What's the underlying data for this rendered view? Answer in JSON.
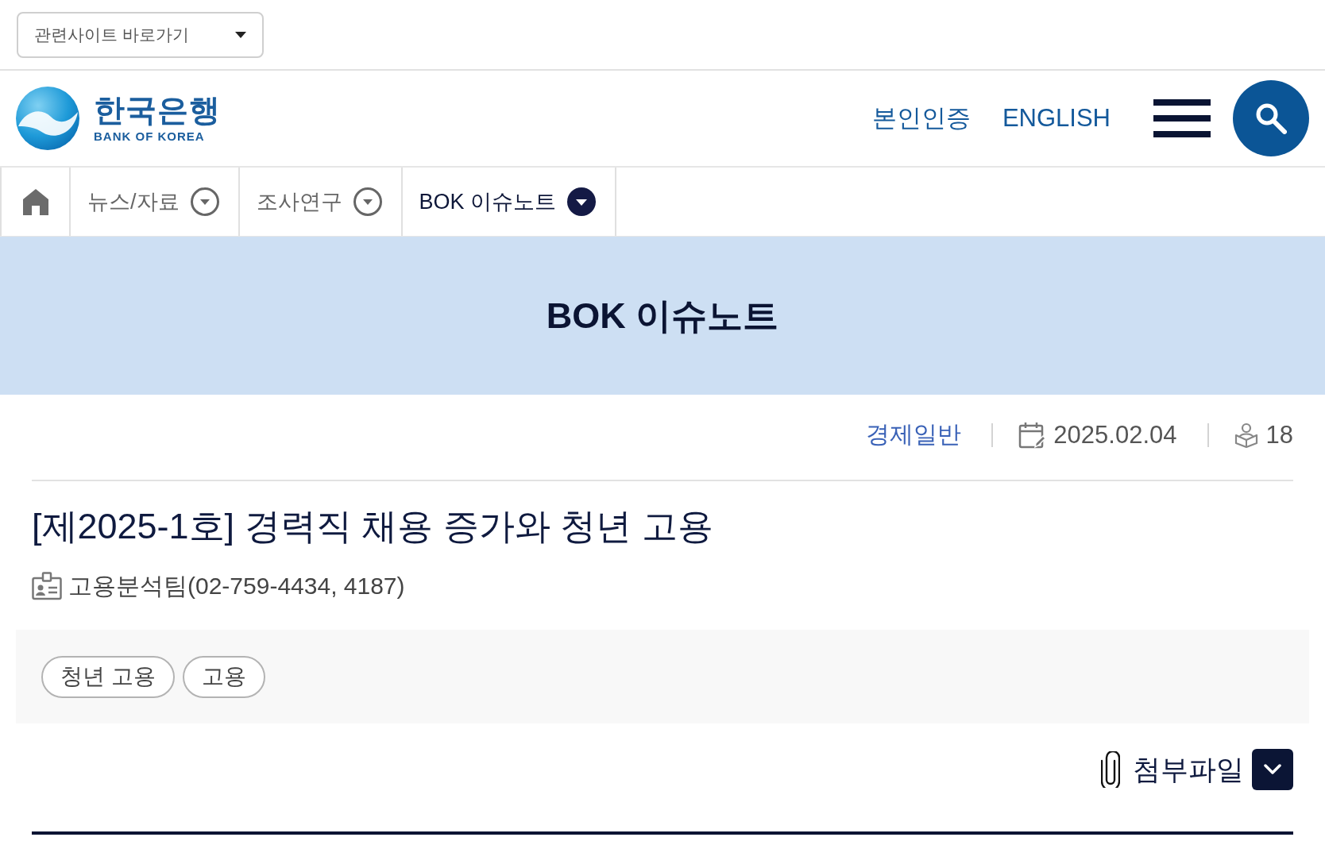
{
  "related_sites": {
    "label": "관련사이트 바로가기"
  },
  "header": {
    "logo": {
      "name_ko": "한국은행",
      "name_en": "BANK OF KOREA"
    },
    "links": [
      "본인인증",
      "ENGLISH"
    ]
  },
  "nav": {
    "items": [
      {
        "label": "뉴스/자료",
        "selected": false
      },
      {
        "label": "조사연구",
        "selected": false
      },
      {
        "label": "BOK 이슈노트",
        "selected": true
      }
    ]
  },
  "banner": {
    "title": "BOK 이슈노트"
  },
  "article": {
    "category": "경제일반",
    "date": "2025.02.04",
    "views": "18",
    "title": "[제2025-1호] 경력직 채용 증가와 청년 고용",
    "author": "고용분석팀(02-759-4434, 4187)",
    "tags": [
      "청년 고용",
      "고용"
    ],
    "attachments": {
      "label": "첨부파일",
      "expanded": false
    }
  }
}
